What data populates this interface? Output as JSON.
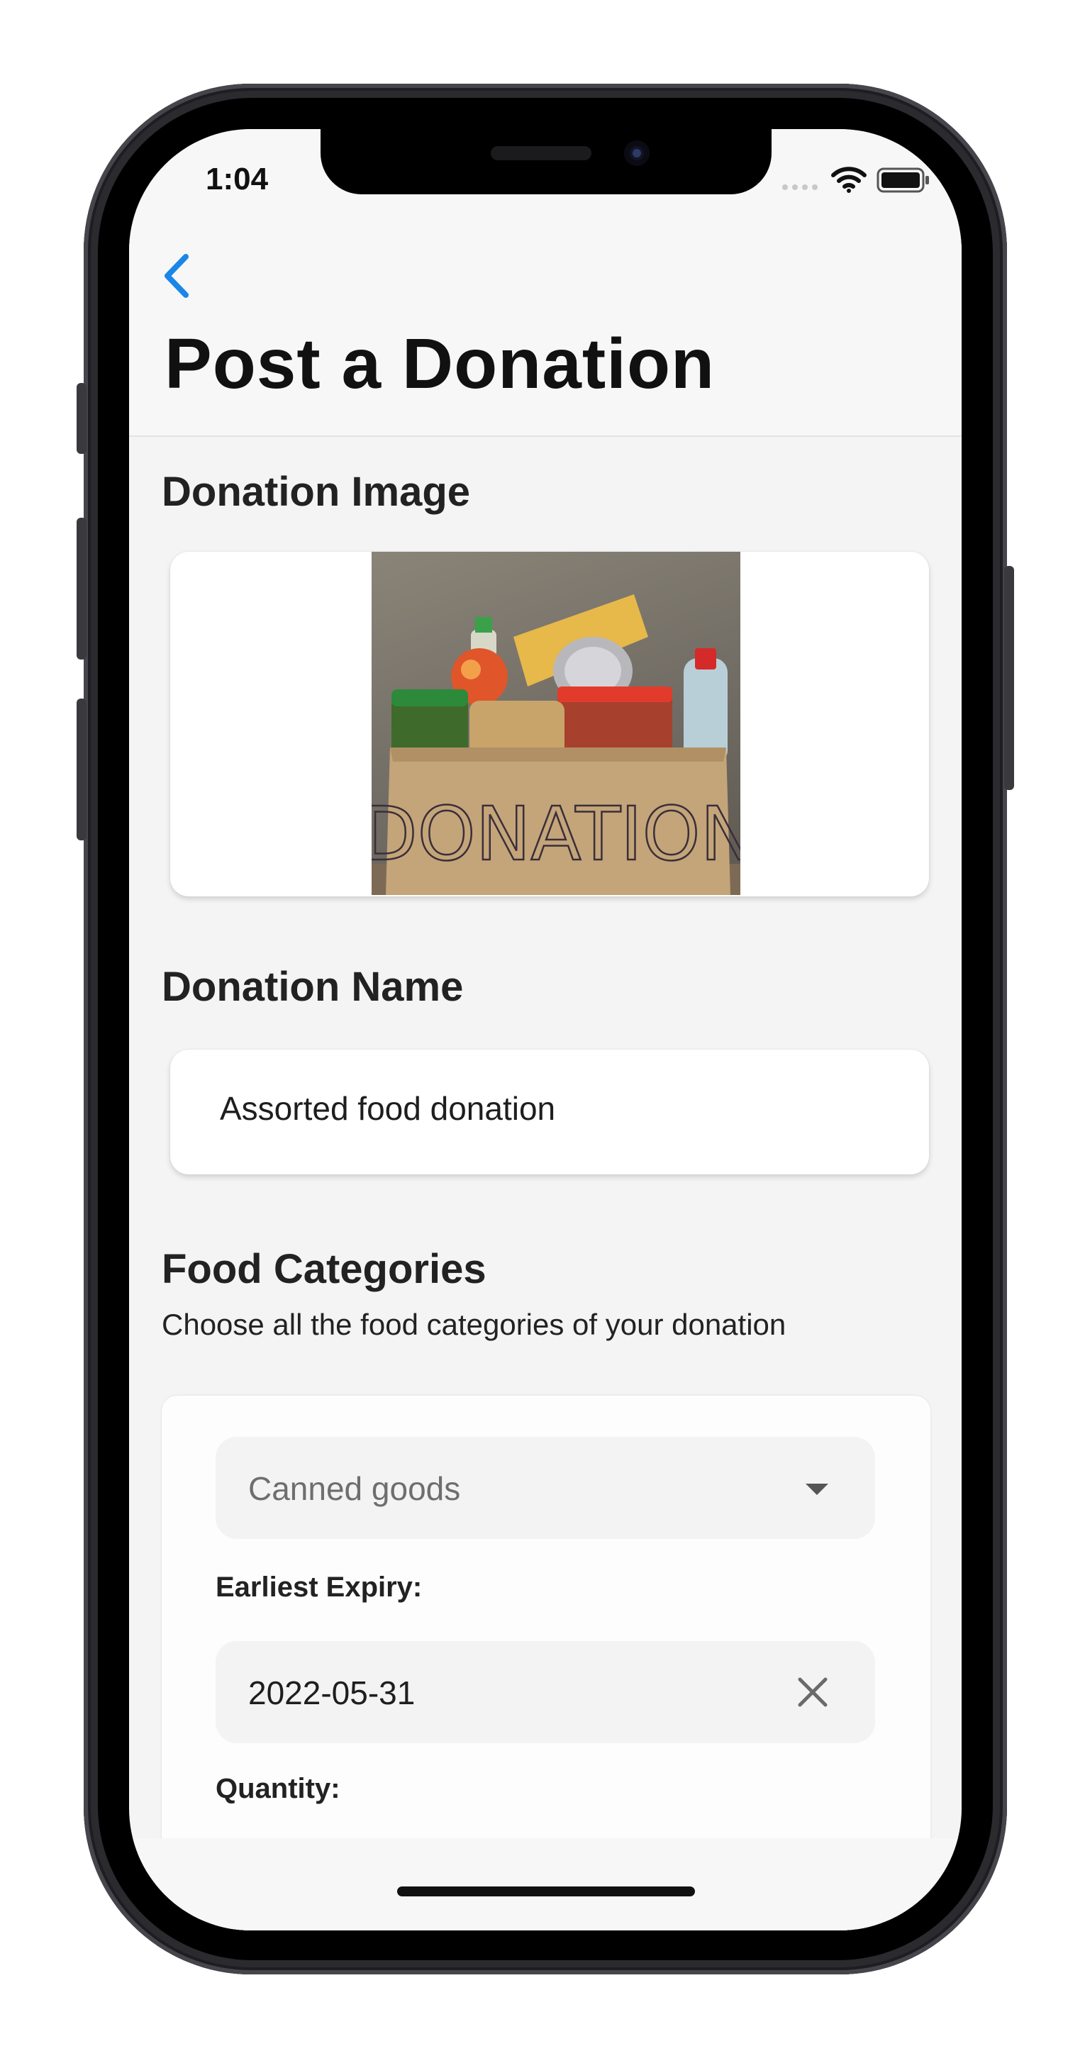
{
  "status_bar": {
    "time": "1:04",
    "icons": [
      "signal-dots-icon",
      "wifi-icon",
      "battery-icon"
    ]
  },
  "nav": {
    "back_icon": "chevron-left-icon",
    "accent_color": "#1a86e8",
    "title": "Post a Donation"
  },
  "donation_image": {
    "section_title": "Donation Image",
    "image_text": "DONATION"
  },
  "donation_name": {
    "section_title": "Donation Name",
    "value": "Assorted food donation"
  },
  "food_categories": {
    "section_title": "Food Categories",
    "subtitle": "Choose all the food categories of your donation",
    "category_select": {
      "selected": "Canned goods",
      "icon": "dropdown-arrow-icon"
    },
    "expiry": {
      "label": "Earliest Expiry:",
      "value": "2022-05-31",
      "clear_icon": "clear-x-icon"
    },
    "quantity": {
      "label": "Quantity:"
    }
  }
}
